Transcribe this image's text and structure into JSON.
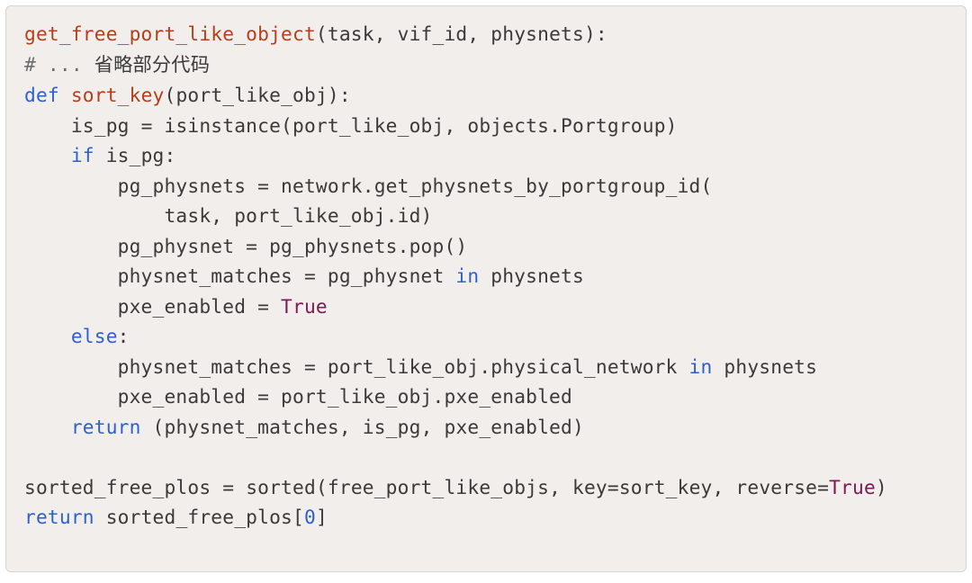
{
  "code": {
    "lines": [
      [
        {
          "cls": "tok-name",
          "t": "get_free_port_like_object"
        },
        {
          "cls": "tok-punct",
          "t": "("
        },
        {
          "cls": "tok-default",
          "t": "task"
        },
        {
          "cls": "tok-punct",
          "t": ", "
        },
        {
          "cls": "tok-default",
          "t": "vif_id"
        },
        {
          "cls": "tok-punct",
          "t": ", "
        },
        {
          "cls": "tok-default",
          "t": "physnets"
        },
        {
          "cls": "tok-punct",
          "t": ")"
        },
        {
          "cls": "tok-punct",
          "t": ":"
        }
      ],
      [
        {
          "cls": "tok-comment",
          "t": "# ... "
        },
        {
          "cls": "tok-cjk",
          "t": "省略部分代码"
        }
      ],
      [
        {
          "cls": "tok-keyword",
          "t": "def"
        },
        {
          "cls": "tok-default",
          "t": " "
        },
        {
          "cls": "tok-name",
          "t": "sort_key"
        },
        {
          "cls": "tok-punct",
          "t": "("
        },
        {
          "cls": "tok-default",
          "t": "port_like_obj"
        },
        {
          "cls": "tok-punct",
          "t": ")"
        },
        {
          "cls": "tok-punct",
          "t": ":"
        }
      ],
      [
        {
          "cls": "tok-default",
          "t": "    is_pg "
        },
        {
          "cls": "tok-punct",
          "t": "= "
        },
        {
          "cls": "tok-default",
          "t": "isinstance"
        },
        {
          "cls": "tok-punct",
          "t": "("
        },
        {
          "cls": "tok-default",
          "t": "port_like_obj"
        },
        {
          "cls": "tok-punct",
          "t": ", "
        },
        {
          "cls": "tok-default",
          "t": "objects"
        },
        {
          "cls": "tok-punct",
          "t": "."
        },
        {
          "cls": "tok-default",
          "t": "Portgroup"
        },
        {
          "cls": "tok-punct",
          "t": ")"
        }
      ],
      [
        {
          "cls": "tok-default",
          "t": "    "
        },
        {
          "cls": "tok-keyword",
          "t": "if"
        },
        {
          "cls": "tok-default",
          "t": " is_pg"
        },
        {
          "cls": "tok-punct",
          "t": ":"
        }
      ],
      [
        {
          "cls": "tok-default",
          "t": "        pg_physnets "
        },
        {
          "cls": "tok-punct",
          "t": "= "
        },
        {
          "cls": "tok-default",
          "t": "network"
        },
        {
          "cls": "tok-punct",
          "t": "."
        },
        {
          "cls": "tok-default",
          "t": "get_physnets_by_portgroup_id"
        },
        {
          "cls": "tok-punct",
          "t": "("
        }
      ],
      [
        {
          "cls": "tok-default",
          "t": "            task"
        },
        {
          "cls": "tok-punct",
          "t": ", "
        },
        {
          "cls": "tok-default",
          "t": "port_like_obj"
        },
        {
          "cls": "tok-punct",
          "t": "."
        },
        {
          "cls": "tok-default",
          "t": "id"
        },
        {
          "cls": "tok-punct",
          "t": ")"
        }
      ],
      [
        {
          "cls": "tok-default",
          "t": "        pg_physnet "
        },
        {
          "cls": "tok-punct",
          "t": "= "
        },
        {
          "cls": "tok-default",
          "t": "pg_physnets"
        },
        {
          "cls": "tok-punct",
          "t": "."
        },
        {
          "cls": "tok-default",
          "t": "pop"
        },
        {
          "cls": "tok-punct",
          "t": "()"
        }
      ],
      [
        {
          "cls": "tok-default",
          "t": "        physnet_matches "
        },
        {
          "cls": "tok-punct",
          "t": "= "
        },
        {
          "cls": "tok-default",
          "t": "pg_physnet "
        },
        {
          "cls": "tok-keyword",
          "t": "in"
        },
        {
          "cls": "tok-default",
          "t": " physnets"
        }
      ],
      [
        {
          "cls": "tok-default",
          "t": "        pxe_enabled "
        },
        {
          "cls": "tok-punct",
          "t": "= "
        },
        {
          "cls": "tok-bool",
          "t": "True"
        }
      ],
      [
        {
          "cls": "tok-default",
          "t": "    "
        },
        {
          "cls": "tok-keyword",
          "t": "else"
        },
        {
          "cls": "tok-punct",
          "t": ":"
        }
      ],
      [
        {
          "cls": "tok-default",
          "t": "        physnet_matches "
        },
        {
          "cls": "tok-punct",
          "t": "= "
        },
        {
          "cls": "tok-default",
          "t": "port_like_obj"
        },
        {
          "cls": "tok-punct",
          "t": "."
        },
        {
          "cls": "tok-default",
          "t": "physical_network "
        },
        {
          "cls": "tok-keyword",
          "t": "in"
        },
        {
          "cls": "tok-default",
          "t": " physnets"
        }
      ],
      [
        {
          "cls": "tok-default",
          "t": "        pxe_enabled "
        },
        {
          "cls": "tok-punct",
          "t": "= "
        },
        {
          "cls": "tok-default",
          "t": "port_like_obj"
        },
        {
          "cls": "tok-punct",
          "t": "."
        },
        {
          "cls": "tok-default",
          "t": "pxe_enabled"
        }
      ],
      [
        {
          "cls": "tok-default",
          "t": "    "
        },
        {
          "cls": "tok-keyword",
          "t": "return"
        },
        {
          "cls": "tok-default",
          "t": " "
        },
        {
          "cls": "tok-punct",
          "t": "("
        },
        {
          "cls": "tok-default",
          "t": "physnet_matches"
        },
        {
          "cls": "tok-punct",
          "t": ", "
        },
        {
          "cls": "tok-default",
          "t": "is_pg"
        },
        {
          "cls": "tok-punct",
          "t": ", "
        },
        {
          "cls": "tok-default",
          "t": "pxe_enabled"
        },
        {
          "cls": "tok-punct",
          "t": ")"
        }
      ],
      [],
      [
        {
          "cls": "tok-default",
          "t": "sorted_free_plos "
        },
        {
          "cls": "tok-punct",
          "t": "= "
        },
        {
          "cls": "tok-default",
          "t": "sorted"
        },
        {
          "cls": "tok-punct",
          "t": "("
        },
        {
          "cls": "tok-default",
          "t": "free_port_like_objs"
        },
        {
          "cls": "tok-punct",
          "t": ", "
        },
        {
          "cls": "tok-default",
          "t": "key"
        },
        {
          "cls": "tok-punct",
          "t": "="
        },
        {
          "cls": "tok-default",
          "t": "sort_key"
        },
        {
          "cls": "tok-punct",
          "t": ", "
        },
        {
          "cls": "tok-default",
          "t": "reverse"
        },
        {
          "cls": "tok-punct",
          "t": "="
        },
        {
          "cls": "tok-bool",
          "t": "True"
        },
        {
          "cls": "tok-punct",
          "t": ")"
        }
      ],
      [
        {
          "cls": "tok-keyword",
          "t": "return"
        },
        {
          "cls": "tok-default",
          "t": " sorted_free_plos"
        },
        {
          "cls": "tok-punct",
          "t": "["
        },
        {
          "cls": "tok-number",
          "t": "0"
        },
        {
          "cls": "tok-punct",
          "t": "]"
        }
      ]
    ]
  }
}
